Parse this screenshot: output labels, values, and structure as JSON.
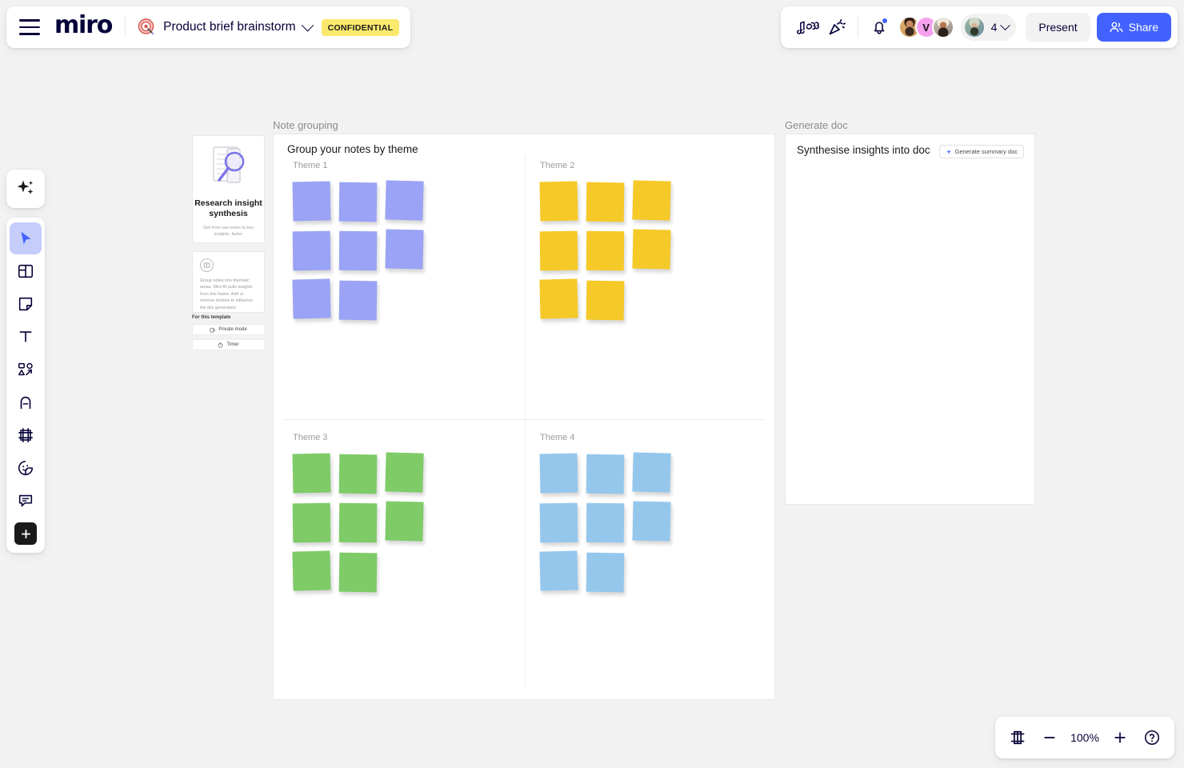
{
  "header": {
    "menu_icon": "hamburger-menu-icon",
    "logo": "miro",
    "board_icon": "target-board-icon",
    "board_title": "Product brief brainstorm",
    "board_title_chevron": "chevron-down-icon",
    "confidential_badge": "CONFIDENTIAL",
    "music_icon": "music-notes-icon",
    "celebrate_icon": "party-popper-icon",
    "bell_icon": "notification-bell-icon",
    "has_notification_dot": true,
    "avatars": [
      {
        "name": "avatar-1",
        "initial": ""
      },
      {
        "name": "avatar-2",
        "initial": "V"
      },
      {
        "name": "avatar-3",
        "initial": ""
      }
    ],
    "users_pill": {
      "avatar": "avatar-4",
      "count": "4",
      "chevron": "chevron-down-icon"
    },
    "present_label": "Present",
    "share_label": "Share",
    "share_icon": "people-icon",
    "share_color": "#4262ff"
  },
  "toolbar": {
    "ai_tool": "sparkle-ai-icon",
    "items": [
      {
        "name": "select-tool",
        "icon": "cursor-arrow-icon",
        "active": true
      },
      {
        "name": "templates-tool",
        "icon": "layout-template-icon",
        "active": false
      },
      {
        "name": "sticky-note-tool",
        "icon": "sticky-note-icon",
        "active": false
      },
      {
        "name": "text-tool",
        "icon": "text-t-icon",
        "active": false
      },
      {
        "name": "shapes-tool",
        "icon": "shapes-connector-icon",
        "active": false
      },
      {
        "name": "pen-tool",
        "icon": "pen-nib-icon",
        "active": false
      },
      {
        "name": "frame-tool",
        "icon": "frame-icon",
        "active": false
      },
      {
        "name": "sticker-tool",
        "icon": "sticker-smiley-icon",
        "active": false
      },
      {
        "name": "comment-tool",
        "icon": "comment-bubble-icon",
        "active": false
      },
      {
        "name": "more-apps-tool",
        "icon": "plus-square-icon",
        "active": false
      }
    ]
  },
  "template_panel": {
    "hero": {
      "art_icon": "document-magnifier-icon",
      "title": "Research insight synthesis",
      "subtitle": "Get from raw notes to key insights, faster"
    },
    "info": {
      "icon": "frame-circle-icon",
      "text": "Group notes into thematic areas. Miro AI pulls insights from this frame. Add or remove stickies to influence the doc generation."
    },
    "section_heading": "For this template",
    "buttons": [
      {
        "name": "private-mode-button",
        "icon": "private-mode-icon",
        "label": "Private mode"
      },
      {
        "name": "timer-button",
        "icon": "timer-icon",
        "label": "Timer"
      }
    ]
  },
  "frames": [
    {
      "name": "note-grouping-frame",
      "label": "Note grouping"
    },
    {
      "name": "generate-doc-frame",
      "label": "Generate doc"
    }
  ],
  "note_grouping": {
    "title": "Group your notes by theme",
    "themes": [
      {
        "label": "Theme 1",
        "color": "#9aa3f5",
        "count": 8
      },
      {
        "label": "Theme 2",
        "color": "#f5c927",
        "count": 8
      },
      {
        "label": "Theme 3",
        "color": "#7ecb68",
        "count": 8
      },
      {
        "label": "Theme 4",
        "color": "#95c7ed",
        "count": 8
      }
    ]
  },
  "generate_doc": {
    "title": "Synthesise insights into doc",
    "button": {
      "icon": "sparkle-icon",
      "label": "Generate summary doc"
    }
  },
  "zoom_controls": {
    "fit_icon": "fit-to-screen-icon",
    "zoom_out_icon": "minus-icon",
    "level": "100%",
    "zoom_in_icon": "plus-icon",
    "help_icon": "question-mark-circle-icon"
  }
}
